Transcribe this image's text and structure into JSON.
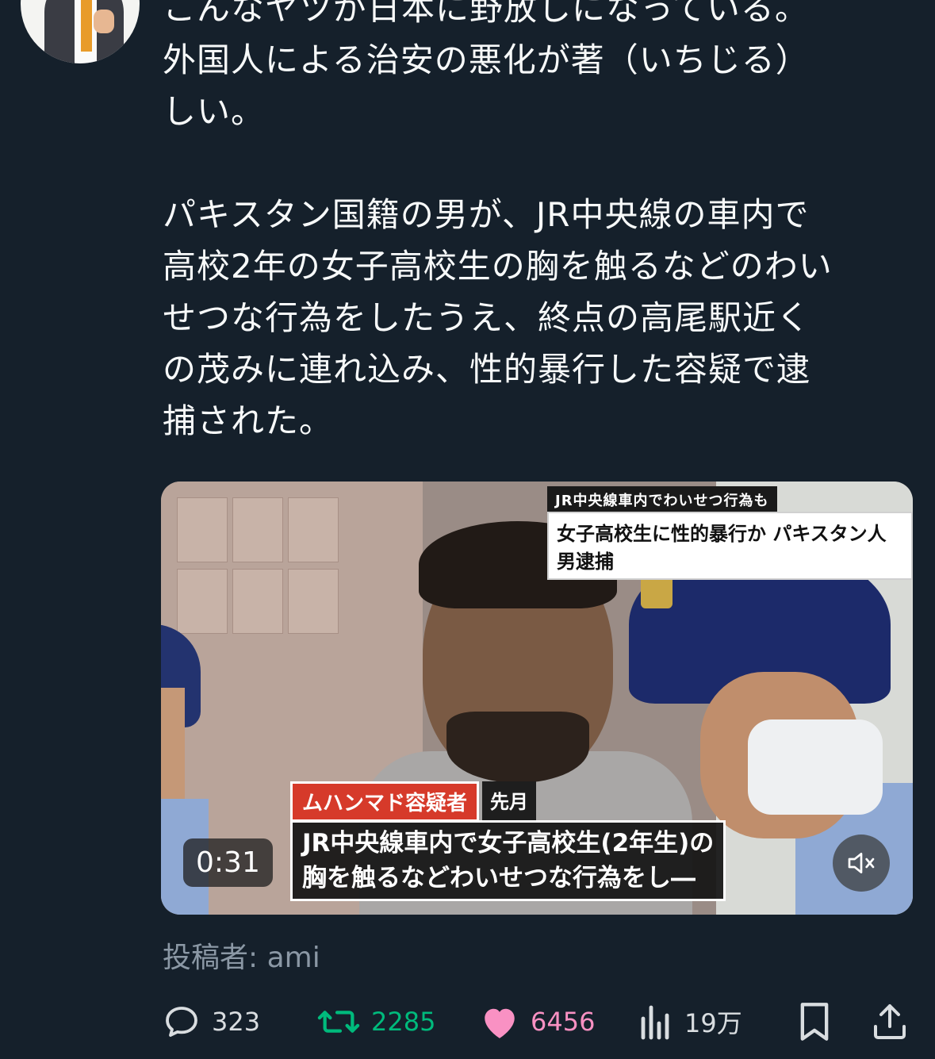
{
  "post": {
    "text": "こんなヤツが日本に野放しになっている。\n外国人による治安の悪化が著（いちじる）\nしい。\n\nパキスタン国籍の男が、JR中央線の車内で\n高校2年の女子高校生の胸を触るなどのわい\nせつな行為をしたうえ、終点の高尾駅近く\nの茂みに連れ込み、性的暴行した容疑で逮\n捕された。"
  },
  "video": {
    "banner_top": "JR中央線車内でわいせつ行為も",
    "banner_main": "女子高校生に性的暴行か パキスタン人男逮捕",
    "name_label": "ムハンマド容疑者",
    "name_date": "先月",
    "subtitle": "JR中央線車内で女子高校生(2年生)の\n胸を触るなどわいせつな行為をし―",
    "duration": "0:31",
    "mute_icon": "speaker-muted-icon"
  },
  "poster": {
    "label": "投稿者: ami"
  },
  "actions": {
    "reply_count": "323",
    "repost_count": "2285",
    "like_count": "6456",
    "view_count": "19万"
  },
  "colors": {
    "background": "#15202b",
    "text": "#f7f9f9",
    "muted": "#8b98a5",
    "repost": "#00ba7c",
    "like": "#f91880"
  }
}
